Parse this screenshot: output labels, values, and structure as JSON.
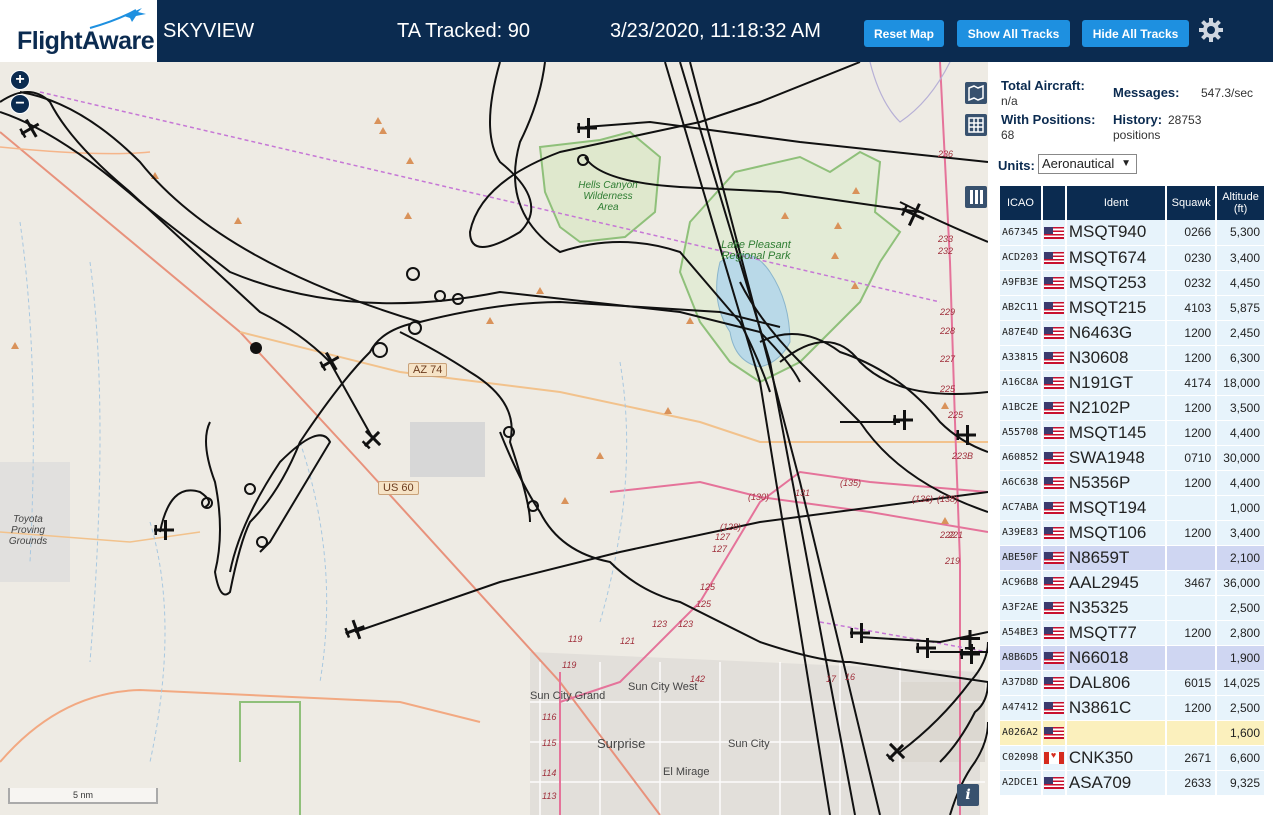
{
  "header": {
    "logo": "FlightAware",
    "app_name": "SKYVIEW",
    "ta_tracked": "TA Tracked: 90",
    "datetime": "3/23/2020, 11:18:32 AM",
    "buttons": {
      "reset_map": "Reset Map",
      "show_all_tracks": "Show All Tracks",
      "hide_all_tracks": "Hide All Tracks"
    },
    "settings_icon": "gear-icon"
  },
  "map": {
    "zoom_in": "+",
    "zoom_out": "−",
    "scale": "5 nm",
    "info": "i",
    "labels": {
      "hells_canyon": "Hells Canyon Wilderness Area",
      "lake_pleasant": "Lake Pleasant Regional Park",
      "toyota": "Toyota Proving Grounds",
      "sun_city_grand": "Sun City Grand",
      "sun_city_west": "Sun City West",
      "surprise": "Surprise",
      "sun_city": "Sun City",
      "el_mirage": "El Mirage",
      "az74": "AZ 74",
      "us60": "US 60"
    }
  },
  "stats": {
    "total_aircraft_label": "Total Aircraft:",
    "total_aircraft_value": "n/a",
    "with_positions_label": "With Positions:",
    "with_positions_value": "68",
    "messages_label": "Messages:",
    "messages_value": "547.3/sec",
    "history_label": "History:",
    "history_value": "28753 positions",
    "units_label": "Units:",
    "units_value": "Aeronautical"
  },
  "table": {
    "headers": [
      "ICAO",
      "",
      "Ident",
      "Squawk",
      "Altitude (ft)"
    ],
    "rows": [
      {
        "icao": "A67345",
        "flag": "us",
        "ident": "MSQT940",
        "squawk": "0266",
        "alt": "5,300",
        "state": ""
      },
      {
        "icao": "ACD203",
        "flag": "us",
        "ident": "MSQT674",
        "squawk": "0230",
        "alt": "3,400",
        "state": ""
      },
      {
        "icao": "A9FB3E",
        "flag": "us",
        "ident": "MSQT253",
        "squawk": "0232",
        "alt": "4,450",
        "state": ""
      },
      {
        "icao": "AB2C11",
        "flag": "us",
        "ident": "MSQT215",
        "squawk": "4103",
        "alt": "5,875",
        "state": ""
      },
      {
        "icao": "A87E4D",
        "flag": "us",
        "ident": "N6463G",
        "squawk": "1200",
        "alt": "2,450",
        "state": ""
      },
      {
        "icao": "A33815",
        "flag": "us",
        "ident": "N30608",
        "squawk": "1200",
        "alt": "6,300",
        "state": ""
      },
      {
        "icao": "A16C8A",
        "flag": "us",
        "ident": "N191GT",
        "squawk": "4174",
        "alt": "18,000",
        "state": ""
      },
      {
        "icao": "A1BC2E",
        "flag": "us",
        "ident": "N2102P",
        "squawk": "1200",
        "alt": "3,500",
        "state": ""
      },
      {
        "icao": "A55708",
        "flag": "us",
        "ident": "MSQT145",
        "squawk": "1200",
        "alt": "4,400",
        "state": ""
      },
      {
        "icao": "A60852",
        "flag": "us",
        "ident": "SWA1948",
        "squawk": "0710",
        "alt": "30,000",
        "state": ""
      },
      {
        "icao": "A6C638",
        "flag": "us",
        "ident": "N5356P",
        "squawk": "1200",
        "alt": "4,400",
        "state": ""
      },
      {
        "icao": "AC7ABA",
        "flag": "us",
        "ident": "MSQT194",
        "squawk": "",
        "alt": "1,000",
        "state": ""
      },
      {
        "icao": "A39E83",
        "flag": "us",
        "ident": "MSQT106",
        "squawk": "1200",
        "alt": "3,400",
        "state": ""
      },
      {
        "icao": "ABE50F",
        "flag": "us",
        "ident": "N8659T",
        "squawk": "",
        "alt": "2,100",
        "state": "sel"
      },
      {
        "icao": "AC96B8",
        "flag": "us",
        "ident": "AAL2945",
        "squawk": "3467",
        "alt": "36,000",
        "state": ""
      },
      {
        "icao": "A3F2AE",
        "flag": "us",
        "ident": "N35325",
        "squawk": "",
        "alt": "2,500",
        "state": ""
      },
      {
        "icao": "A54BE3",
        "flag": "us",
        "ident": "MSQT77",
        "squawk": "1200",
        "alt": "2,800",
        "state": ""
      },
      {
        "icao": "A8B6D5",
        "flag": "us",
        "ident": "N66018",
        "squawk": "",
        "alt": "1,900",
        "state": "sel"
      },
      {
        "icao": "A37D8D",
        "flag": "us",
        "ident": "DAL806",
        "squawk": "6015",
        "alt": "14,025",
        "state": ""
      },
      {
        "icao": "A47412",
        "flag": "us",
        "ident": "N3861C",
        "squawk": "1200",
        "alt": "2,500",
        "state": ""
      },
      {
        "icao": "A026A2",
        "flag": "us",
        "ident": "",
        "squawk": "",
        "alt": "1,600",
        "state": "hl"
      },
      {
        "icao": "C02098",
        "flag": "ca",
        "ident": "CNK350",
        "squawk": "2671",
        "alt": "6,600",
        "state": ""
      },
      {
        "icao": "A2DCE1",
        "flag": "us",
        "ident": "ASA709",
        "squawk": "2633",
        "alt": "9,325",
        "state": ""
      }
    ]
  },
  "colors": {
    "header_bg": "#0b2b50",
    "button_bg": "#1e90e0",
    "row_bg": "#e7f3fb",
    "row_selected": "#cfd6f2",
    "row_highlight": "#fbf0bd"
  }
}
